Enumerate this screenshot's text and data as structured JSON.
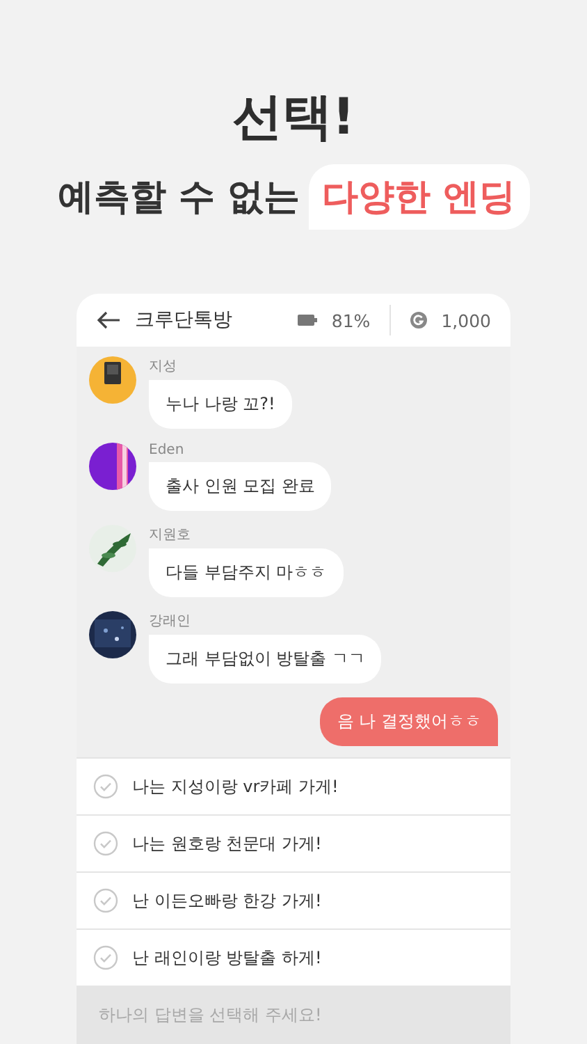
{
  "headline": "선택!",
  "subline": {
    "text": "예측할 수 없는",
    "highlight": "다양한 엔딩"
  },
  "chat": {
    "title": "크루단톡방",
    "battery": "81%",
    "coins": "1,000",
    "messages": [
      {
        "kind": "incoming",
        "sender": "지성",
        "text": "누나 나랑 꼬?!"
      },
      {
        "kind": "incoming",
        "sender": "Eden",
        "text": "출사 인원 모집 완료"
      },
      {
        "kind": "incoming",
        "sender": "지원호",
        "text": "다들 부담주지 마ㅎㅎ"
      },
      {
        "kind": "incoming",
        "sender": "강래인",
        "text": "그래 부담없이 방탈출 ㄱㄱ"
      },
      {
        "kind": "outgoing",
        "text": "음 나 결정했어ㅎㅎ"
      }
    ],
    "options": [
      "나는 지성이랑 vr카페 가게!",
      "나는 원호랑 천문대 가게!",
      "난 이든오빠랑 한강 가게!",
      "난 래인이랑 방탈출 하게!"
    ],
    "answer": {
      "placeholder": "하나의 답변을 선택해 주세요!"
    }
  }
}
